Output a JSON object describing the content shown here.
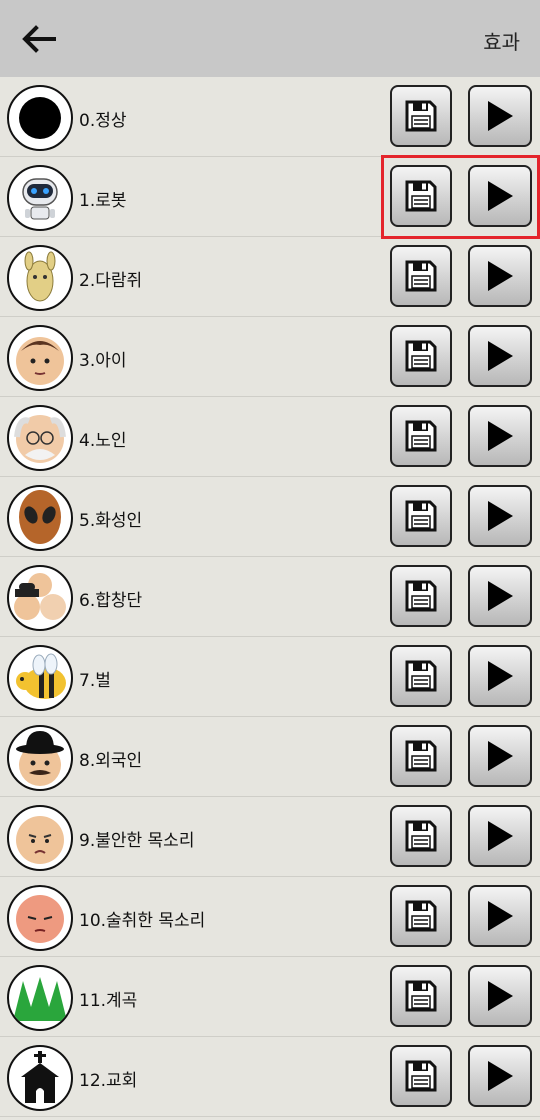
{
  "header": {
    "title": "효과",
    "back_icon": "arrow-left-icon"
  },
  "highlight_color": "#e4252c",
  "effects": [
    {
      "label": "0.정상",
      "icon": "black-dot-icon"
    },
    {
      "label": "1.로봇",
      "icon": "robot-icon",
      "highlighted": true
    },
    {
      "label": "2.다람쥐",
      "icon": "squirrel-icon"
    },
    {
      "label": "3.아이",
      "icon": "child-face-icon"
    },
    {
      "label": "4.노인",
      "icon": "old-man-face-icon"
    },
    {
      "label": "5.화성인",
      "icon": "alien-face-icon"
    },
    {
      "label": "6.합창단",
      "icon": "choir-faces-icon"
    },
    {
      "label": "7.벌",
      "icon": "bee-icon"
    },
    {
      "label": "8.외국인",
      "icon": "foreigner-bowler-hat-icon"
    },
    {
      "label": "9.불안한 목소리",
      "icon": "anxious-face-icon"
    },
    {
      "label": "10.술취한 목소리",
      "icon": "drunk-face-icon"
    },
    {
      "label": "11.계곡",
      "icon": "valley-mountains-icon"
    },
    {
      "label": "12.교회",
      "icon": "church-icon"
    }
  ],
  "row_buttons": {
    "save_icon": "floppy-disk-icon",
    "play_icon": "play-icon"
  }
}
